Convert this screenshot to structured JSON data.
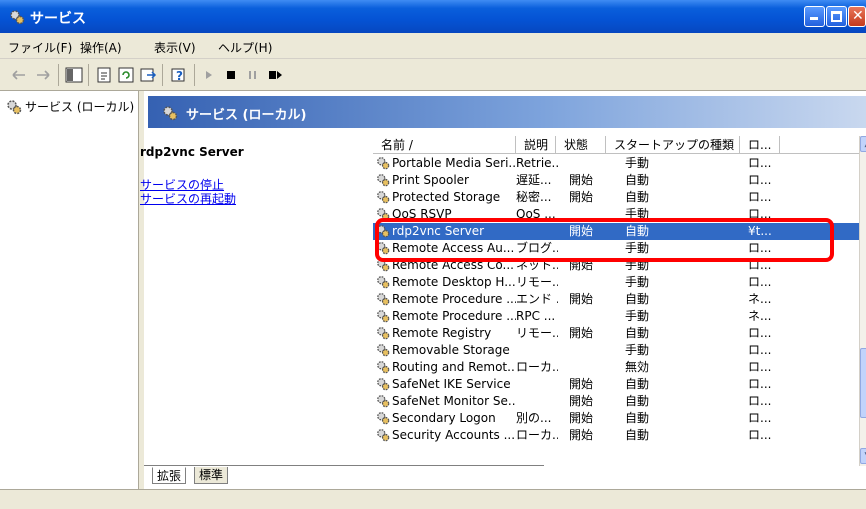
{
  "window": {
    "title": "サービス",
    "icon": "services-gear-icon"
  },
  "menu": [
    "ファイル(F)",
    "操作(A)",
    "表示(V)",
    "ヘルプ(H)"
  ],
  "toolbar": [
    "back-arrow-icon",
    "forward-arrow-icon",
    "show-tree-icon",
    "properties-icon",
    "refresh-icon",
    "export-icon",
    "help-icon",
    "play-icon",
    "stop-icon",
    "pause-icon",
    "restart-icon"
  ],
  "tree": {
    "label": "サービス (ローカル)"
  },
  "banner": {
    "title": "サービス (ローカル)"
  },
  "description": {
    "service_name": "rdp2vnc Server",
    "link_stop": "サービスの停止",
    "link_restart": "サービスの再起動"
  },
  "columns": [
    "名前 /",
    "説明",
    "状態",
    "スタートアップの種類",
    "ロ..."
  ],
  "rows": [
    {
      "name": "Portable Media Seri...",
      "desc": "Retrie...",
      "status": "",
      "startup": "手動",
      "logon": "ロ..."
    },
    {
      "name": "Print Spooler",
      "desc": "遅延...",
      "status": "開始",
      "startup": "自動",
      "logon": "ロ..."
    },
    {
      "name": "Protected Storage",
      "desc": "秘密...",
      "status": "開始",
      "startup": "自動",
      "logon": "ロ..."
    },
    {
      "name": "QoS RSVP",
      "desc": "QoS ...",
      "status": "",
      "startup": "手動",
      "logon": "ロ..."
    },
    {
      "name": "rdp2vnc Server",
      "desc": "",
      "status": "開始",
      "startup": "自動",
      "logon": "¥t..."
    },
    {
      "name": "Remote Access Au...",
      "desc": "ブログ...",
      "status": "",
      "startup": "手動",
      "logon": "ロ..."
    },
    {
      "name": "Remote Access Co...",
      "desc": "ネット...",
      "status": "開始",
      "startup": "手動",
      "logon": "ロ..."
    },
    {
      "name": "Remote Desktop H...",
      "desc": "リモー...",
      "status": "",
      "startup": "手動",
      "logon": "ロ..."
    },
    {
      "name": "Remote Procedure ...",
      "desc": "エンド ...",
      "status": "開始",
      "startup": "自動",
      "logon": "ネ..."
    },
    {
      "name": "Remote Procedure ...",
      "desc": "RPC ...",
      "status": "",
      "startup": "手動",
      "logon": "ネ..."
    },
    {
      "name": "Remote Registry",
      "desc": "リモー...",
      "status": "開始",
      "startup": "自動",
      "logon": "ロ..."
    },
    {
      "name": "Removable Storage",
      "desc": "",
      "status": "",
      "startup": "手動",
      "logon": "ロ..."
    },
    {
      "name": "Routing and Remot...",
      "desc": "ローカ...",
      "status": "",
      "startup": "無効",
      "logon": "ロ..."
    },
    {
      "name": "SafeNet IKE Service",
      "desc": "",
      "status": "開始",
      "startup": "自動",
      "logon": "ロ..."
    },
    {
      "name": "SafeNet Monitor Se...",
      "desc": "",
      "status": "開始",
      "startup": "自動",
      "logon": "ロ..."
    },
    {
      "name": "Secondary Logon",
      "desc": "別の...",
      "status": "開始",
      "startup": "自動",
      "logon": "ロ..."
    },
    {
      "name": "Security Accounts ...",
      "desc": "ローカ...",
      "status": "開始",
      "startup": "自動",
      "logon": "ロ..."
    }
  ],
  "selected_row": 4,
  "tabs": [
    "拡張",
    "標準"
  ],
  "colors": {
    "titlebar": "#0553d4",
    "selection": "#316ac5",
    "highlight": "#ff0000",
    "link": "#0000ee"
  }
}
